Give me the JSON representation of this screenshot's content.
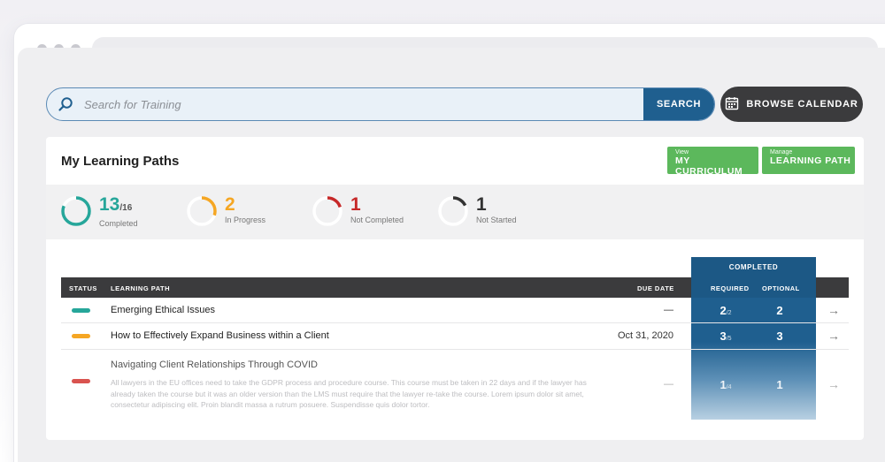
{
  "search": {
    "placeholder": "Search for Training",
    "button_label": "SEARCH"
  },
  "browse_calendar": {
    "label": "BROWSE CALENDAR"
  },
  "card": {
    "title": "My Learning Paths",
    "buttons": [
      {
        "small": "View",
        "big": "MY CURRICULUM"
      },
      {
        "small": "Manage",
        "big": "LEARNING PATH"
      }
    ]
  },
  "stats": [
    {
      "value": "13",
      "of": "/16",
      "label": "Completed",
      "color": "#26a69a",
      "fraction": 0.8125
    },
    {
      "value": "2",
      "of": "",
      "label": "In Progress",
      "color": "#f5a623",
      "fraction": 0.3
    },
    {
      "value": "1",
      "of": "",
      "label": "Not Completed",
      "color": "#c62828",
      "fraction": 0.2
    },
    {
      "value": "1",
      "of": "",
      "label": "Not Started",
      "color": "#333333",
      "fraction": 0.18
    }
  ],
  "table": {
    "completed_header": "COMPLETED",
    "columns": {
      "status": "STATUS",
      "learning_path": "LEARNING PATH",
      "due_date": "DUE DATE",
      "required": "REQUIRED",
      "optional": "OPTIONAL"
    },
    "rows": [
      {
        "status_color": "#26a69a",
        "title": "Emerging Ethical Issues",
        "description": "",
        "due": "—",
        "required": "2",
        "required_of": "/2",
        "optional": "2",
        "arrow": "→"
      },
      {
        "status_color": "#f5a623",
        "title": "How to Effectively Expand Business within a Client",
        "description": "",
        "due": "Oct 31, 2020",
        "required": "3",
        "required_of": "/5",
        "optional": "3",
        "arrow": "→"
      },
      {
        "status_color": "#d9534f",
        "title": "Navigating Client Relationships Through COVID",
        "description": "All lawyers in the EU offices need to take the GDPR process and procedure course. This course must be taken in 22 days and if the lawyer has already taken the course but it was an older version than the LMS must require that the lawyer re-take the course.  Lorem ipsum dolor sit amet, consectetur adipiscing elit. Proin blandit massa a rutrum posuere. Suspendisse quis dolor tortor.",
        "due": "—",
        "required": "1",
        "required_of": "/4",
        "optional": "1",
        "arrow": "→"
      }
    ]
  }
}
